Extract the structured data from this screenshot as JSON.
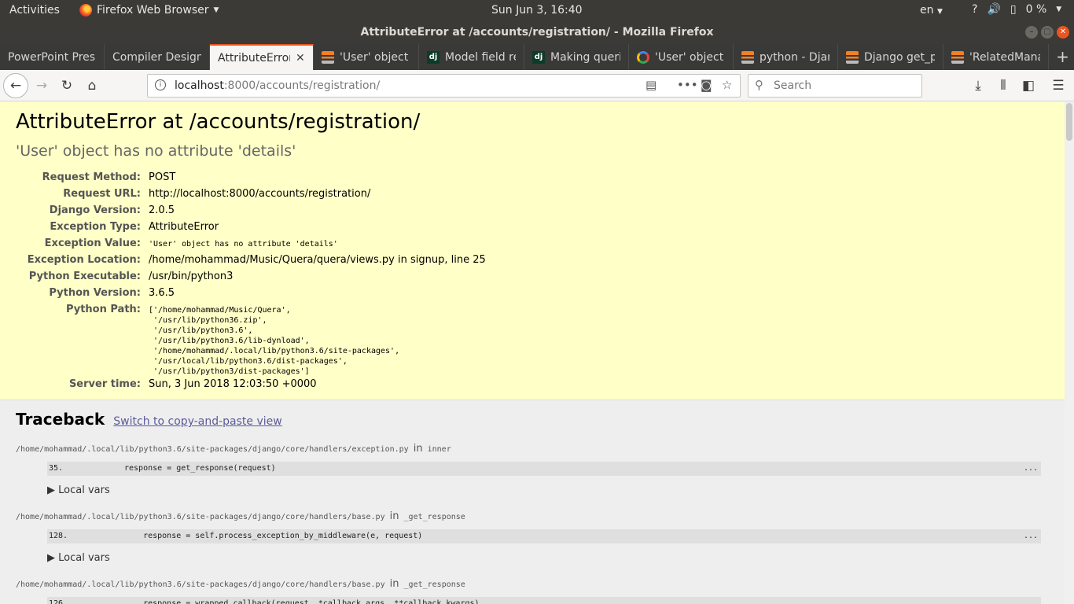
{
  "topbar": {
    "activities": "Activities",
    "app_name": "Firefox Web Browser",
    "clock": "Sun Jun  3, 16:40",
    "lang": "en",
    "battery": "0 %"
  },
  "window": {
    "title": "AttributeError at /accounts/registration/ - Mozilla Firefox"
  },
  "tabs": [
    {
      "label": "PowerPoint Pres",
      "icon": "none"
    },
    {
      "label": "Compiler Design",
      "icon": "none"
    },
    {
      "label": "AttributeError",
      "icon": "none"
    },
    {
      "label": "'User' object",
      "icon": "stackoverflow-icon"
    },
    {
      "label": "Model field re",
      "icon": "django-icon"
    },
    {
      "label": "Making querie",
      "icon": "django-icon"
    },
    {
      "label": "'User' object",
      "icon": "google-icon"
    },
    {
      "label": "python - Djang",
      "icon": "stackoverflow-icon"
    },
    {
      "label": "Django get_p",
      "icon": "stackoverflow-icon"
    },
    {
      "label": "'RelatedMana",
      "icon": "stackoverflow-icon"
    }
  ],
  "url": {
    "host": "localhost",
    "path": ":8000/accounts/registration/"
  },
  "search": {
    "placeholder": "Search"
  },
  "error": {
    "title": "AttributeError at /accounts/registration/",
    "value": "'User' object has no attribute 'details'",
    "meta": [
      {
        "key": "Request Method:",
        "value": "POST"
      },
      {
        "key": "Request URL:",
        "value": "http://localhost:8000/accounts/registration/"
      },
      {
        "key": "Django Version:",
        "value": "2.0.5"
      },
      {
        "key": "Exception Type:",
        "value": "AttributeError"
      },
      {
        "key": "Exception Value:",
        "value": "'User' object has no attribute 'details'"
      },
      {
        "key": "Exception Location:",
        "value": "/home/mohammad/Music/Quera/quera/views.py in signup, line 25"
      },
      {
        "key": "Python Executable:",
        "value": "/usr/bin/python3"
      },
      {
        "key": "Python Version:",
        "value": "3.6.5"
      },
      {
        "key": "Python Path:",
        "value": "['/home/mohammad/Music/Quera',\n '/usr/lib/python36.zip',\n '/usr/lib/python3.6',\n '/usr/lib/python3.6/lib-dynload',\n '/home/mohammad/.local/lib/python3.6/site-packages',\n '/usr/local/lib/python3.6/dist-packages',\n '/usr/lib/python3/dist-packages']"
      },
      {
        "key": "Server time:",
        "value": "Sun, 3 Jun 2018 12:03:50 +0000"
      }
    ]
  },
  "traceback": {
    "heading": "Traceback",
    "switch_link": "Switch to copy-and-paste view",
    "in_word": "in",
    "local_vars": "▶ Local vars",
    "frames": [
      {
        "file": "/home/mohammad/.local/lib/python3.6/site-packages/django/core/handlers/exception.py",
        "func": "inner",
        "line_no": "35.",
        "code": "response = get_response(request)",
        "dots": "..."
      },
      {
        "file": "/home/mohammad/.local/lib/python3.6/site-packages/django/core/handlers/base.py",
        "func": "_get_response",
        "line_no": "128.",
        "code": "    response = self.process_exception_by_middleware(e, request)",
        "dots": "..."
      },
      {
        "file": "/home/mohammad/.local/lib/python3.6/site-packages/django/core/handlers/base.py",
        "func": "_get_response",
        "line_no": "126.",
        "code": "    response = wrapped_callback(request, *callback_args, **callback_kwargs)",
        "dots": "..."
      }
    ]
  }
}
